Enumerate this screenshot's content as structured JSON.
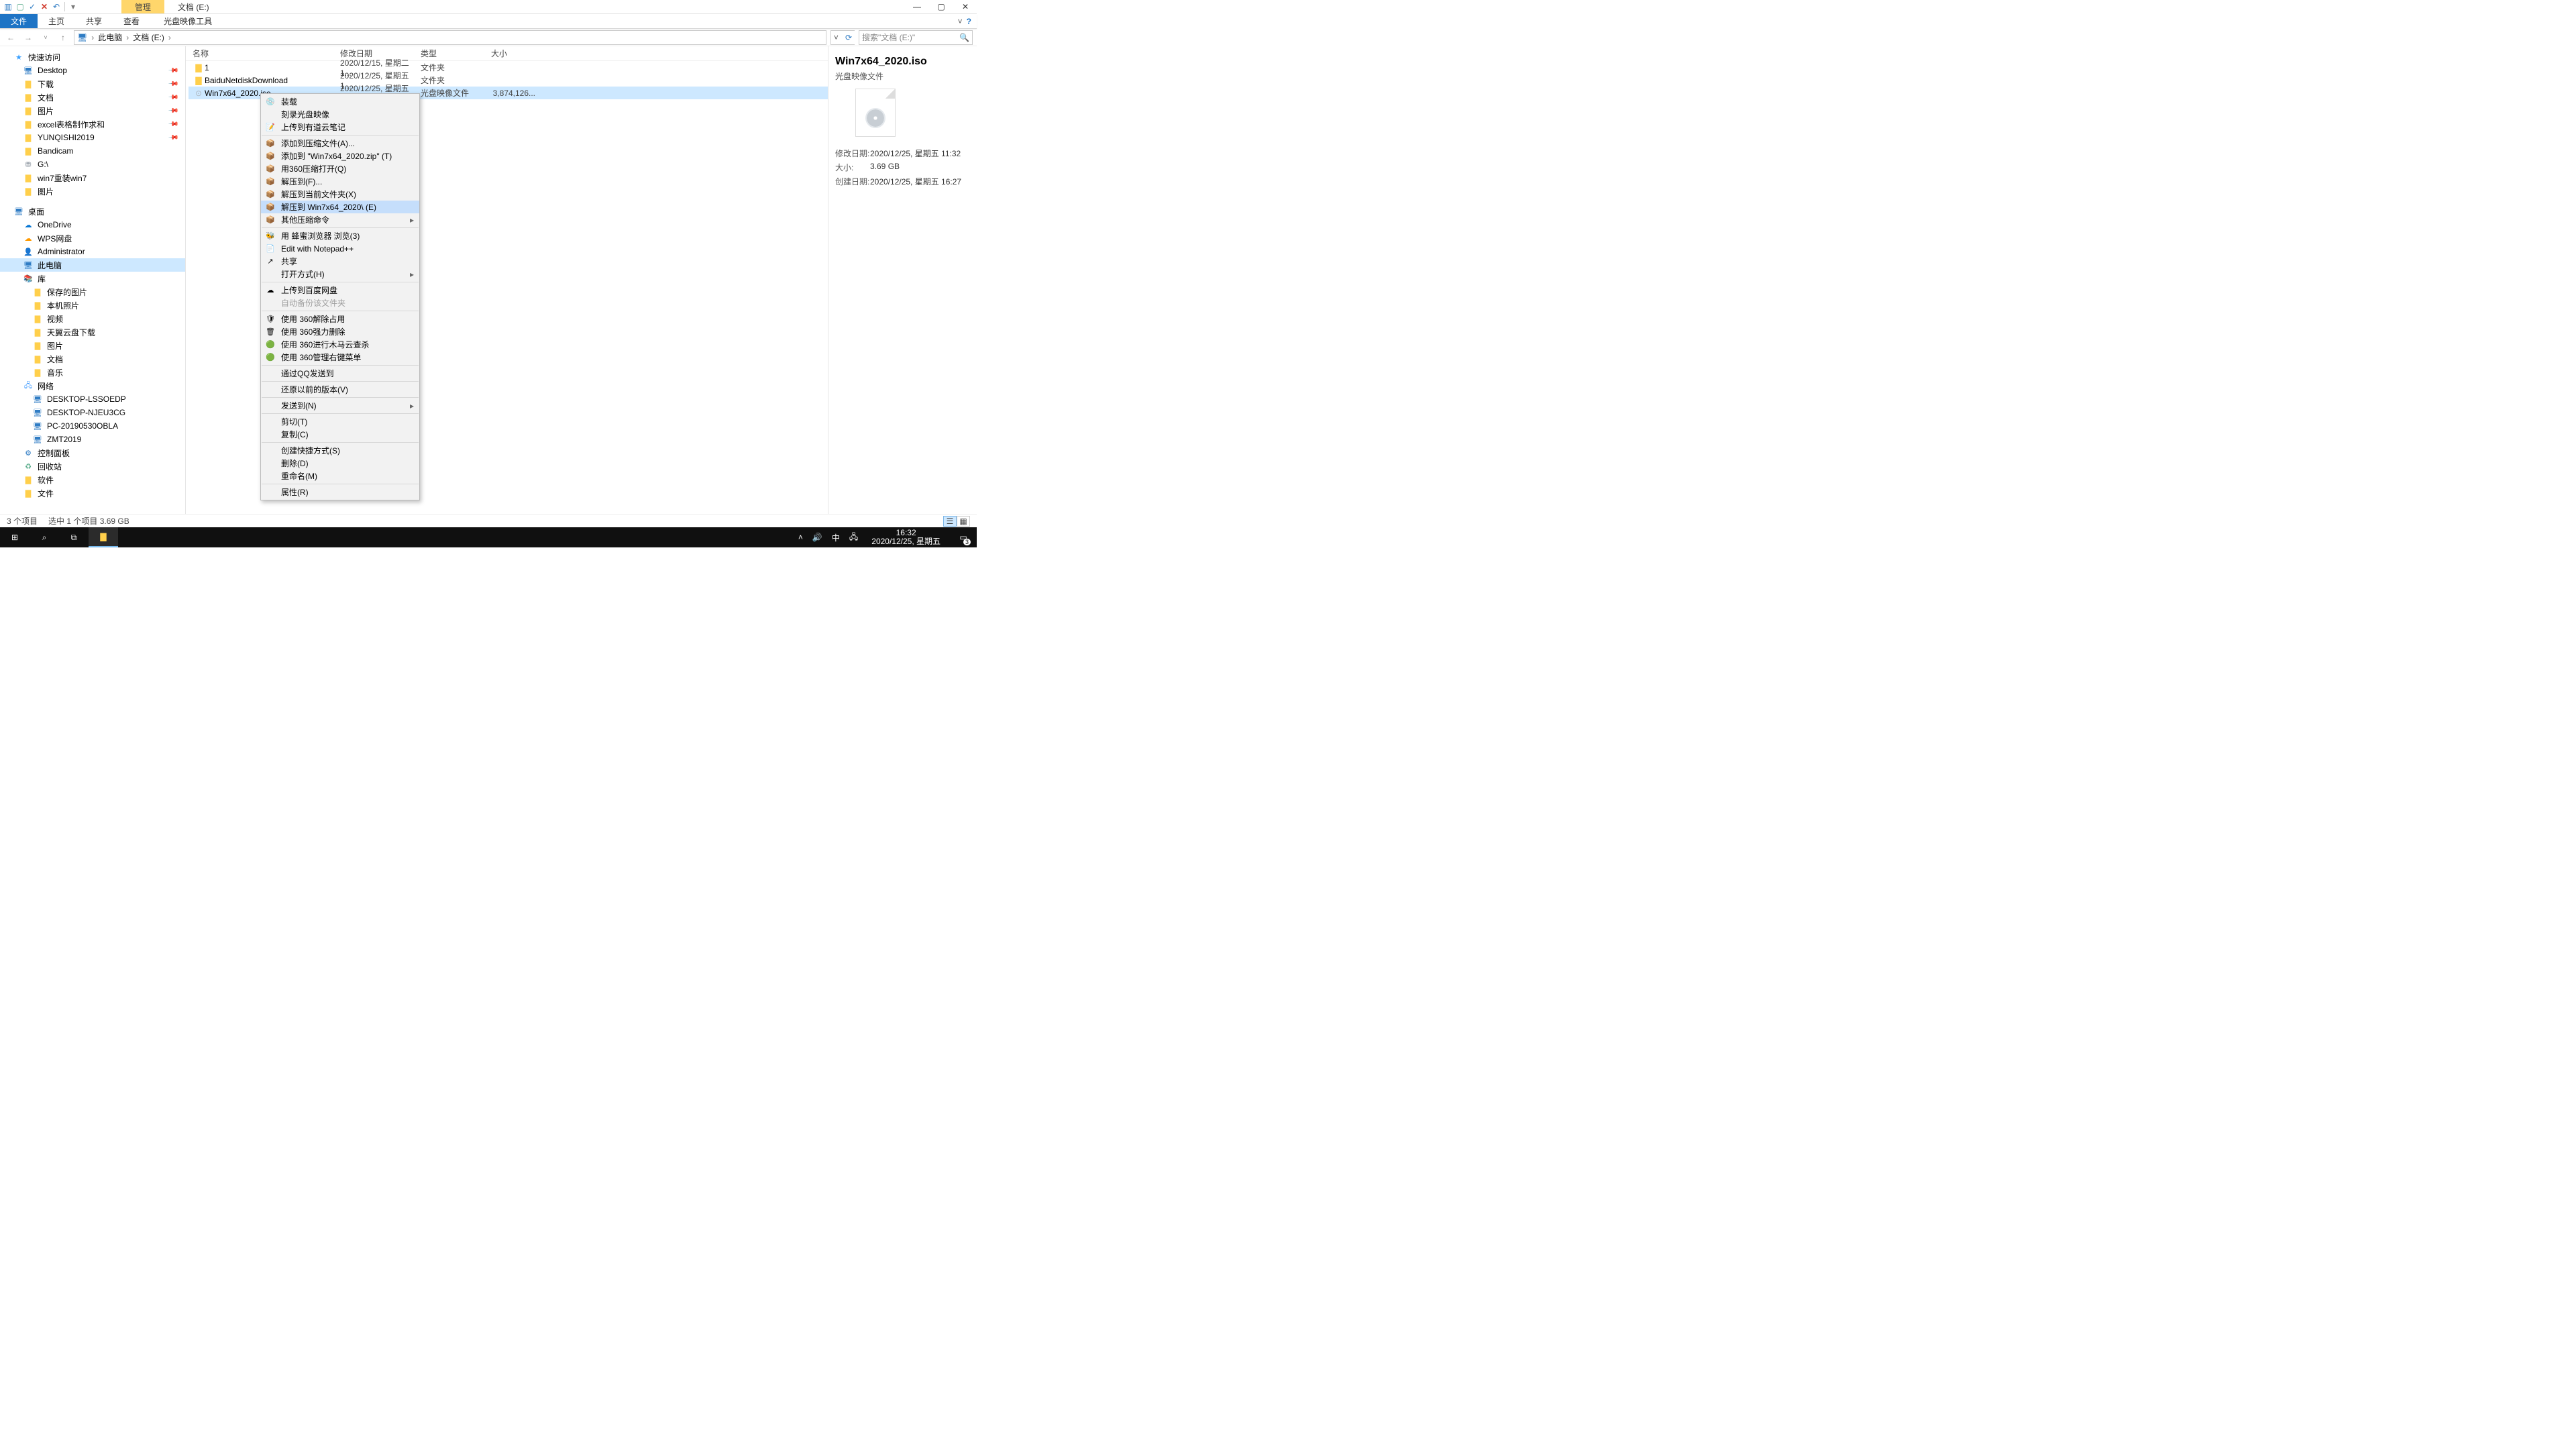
{
  "titlebar": {
    "manage_tab": "管理",
    "title": "文档 (E:)"
  },
  "ribbon": {
    "file": "文件",
    "home": "主页",
    "share": "共享",
    "view": "查看",
    "tool": "光盘映像工具"
  },
  "breadcrumb": {
    "root": "此电脑",
    "loc": "文档 (E:)"
  },
  "search": {
    "placeholder": "搜索\"文档 (E:)\""
  },
  "tree": {
    "quick": {
      "label": "快速访问",
      "items": [
        "Desktop",
        "下载",
        "文档",
        "图片",
        "excel表格制作求和",
        "YUNQISHI2019",
        "Bandicam",
        "G:\\",
        "win7重装win7",
        "图片"
      ]
    },
    "desktop": {
      "label": "桌面",
      "items": [
        "OneDrive",
        "WPS网盘",
        "Administrator",
        "此电脑",
        "库"
      ],
      "lib_items": [
        "保存的图片",
        "本机照片",
        "视频",
        "天翼云盘下载",
        "图片",
        "文档",
        "音乐"
      ],
      "tail": [
        "网络"
      ],
      "net_items": [
        "DESKTOP-LSSOEDP",
        "DESKTOP-NJEU3CG",
        "PC-20190530OBLA",
        "ZMT2019"
      ],
      "tail2": [
        "控制面板",
        "回收站",
        "软件",
        "文件"
      ]
    }
  },
  "columns": {
    "name": "名称",
    "modified": "修改日期",
    "type": "类型",
    "size": "大小"
  },
  "rows": [
    {
      "icon": "folder",
      "name": "1",
      "mod": "2020/12/15, 星期二 1...",
      "type": "文件夹",
      "size": ""
    },
    {
      "icon": "folder",
      "name": "BaiduNetdiskDownload",
      "mod": "2020/12/25, 星期五 1...",
      "type": "文件夹",
      "size": ""
    },
    {
      "icon": "iso",
      "name": "Win7x64_2020.iso",
      "mod": "2020/12/25, 星期五 1...",
      "type": "光盘映像文件",
      "size": "3,874,126...",
      "selected": true
    }
  ],
  "context_menu": [
    {
      "t": "装载",
      "ic": "disc"
    },
    {
      "t": "刻录光盘映像"
    },
    {
      "t": "上传到有道云笔记",
      "ic": "note"
    },
    {
      "sep": true
    },
    {
      "t": "添加到压缩文件(A)...",
      "ic": "zip"
    },
    {
      "t": "添加到 \"Win7x64_2020.zip\" (T)",
      "ic": "zip"
    },
    {
      "t": "用360压缩打开(Q)",
      "ic": "zip"
    },
    {
      "t": "解压到(F)...",
      "ic": "zip"
    },
    {
      "t": "解压到当前文件夹(X)",
      "ic": "zip"
    },
    {
      "t": "解压到 Win7x64_2020\\ (E)",
      "ic": "zip",
      "hover": true
    },
    {
      "t": "其他压缩命令",
      "ic": "zip",
      "sub": true
    },
    {
      "sep": true
    },
    {
      "t": "用 蜂蜜浏览器 浏览(3)",
      "ic": "bee"
    },
    {
      "t": "Edit with Notepad++",
      "ic": "npp"
    },
    {
      "t": "共享",
      "ic": "share"
    },
    {
      "t": "打开方式(H)",
      "sub": true
    },
    {
      "sep": true
    },
    {
      "t": "上传到百度网盘",
      "ic": "baidu"
    },
    {
      "t": "自动备份该文件夹",
      "disabled": true
    },
    {
      "sep": true
    },
    {
      "t": "使用 360解除占用",
      "ic": "360y"
    },
    {
      "t": "使用 360强力删除",
      "ic": "360p"
    },
    {
      "t": "使用 360进行木马云查杀",
      "ic": "360g"
    },
    {
      "t": "使用 360管理右键菜单",
      "ic": "360g"
    },
    {
      "sep": true
    },
    {
      "t": "通过QQ发送到"
    },
    {
      "sep": true
    },
    {
      "t": "还原以前的版本(V)"
    },
    {
      "sep": true
    },
    {
      "t": "发送到(N)",
      "sub": true
    },
    {
      "sep": true
    },
    {
      "t": "剪切(T)"
    },
    {
      "t": "复制(C)"
    },
    {
      "sep": true
    },
    {
      "t": "创建快捷方式(S)"
    },
    {
      "t": "删除(D)"
    },
    {
      "t": "重命名(M)"
    },
    {
      "sep": true
    },
    {
      "t": "属性(R)"
    }
  ],
  "details": {
    "title": "Win7x64_2020.iso",
    "subtitle": "光盘映像文件",
    "modified_k": "修改日期:",
    "modified_v": "2020/12/25, 星期五 11:32",
    "size_k": "大小:",
    "size_v": "3.69 GB",
    "created_k": "创建日期:",
    "created_v": "2020/12/25, 星期五 16:27"
  },
  "status": {
    "count": "3 个项目",
    "selection": "选中 1 个项目  3.69 GB"
  },
  "taskbar": {
    "ime": "中",
    "time": "16:32",
    "date": "2020/12/25, 星期五",
    "notif_count": "3"
  }
}
